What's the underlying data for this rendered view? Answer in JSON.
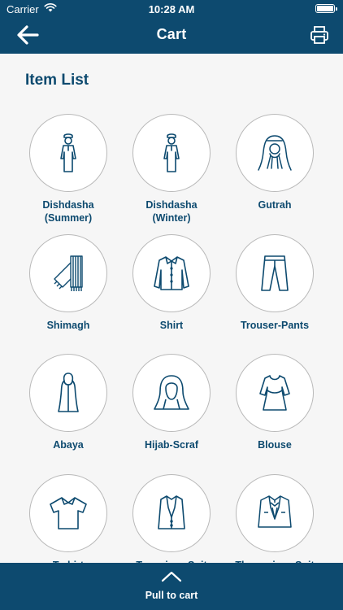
{
  "status_bar": {
    "carrier": "Carrier",
    "time": "10:28 AM"
  },
  "header": {
    "title": "Cart",
    "back_icon": "arrow-left-icon",
    "print_icon": "printer-icon"
  },
  "section": {
    "title": "Item List"
  },
  "items": [
    {
      "label": "Dishdasha\n(Summer)",
      "icon": "dishdasha-icon"
    },
    {
      "label": "Dishdasha\n(Winter)",
      "icon": "dishdasha-icon"
    },
    {
      "label": "Gutrah",
      "icon": "gutrah-icon"
    },
    {
      "label": "Shimagh",
      "icon": "shimagh-icon"
    },
    {
      "label": "Shirt",
      "icon": "shirt-icon"
    },
    {
      "label": "Trouser-Pants",
      "icon": "trousers-icon"
    },
    {
      "label": "Abaya",
      "icon": "abaya-icon"
    },
    {
      "label": "Hijab-Scraf",
      "icon": "hijab-icon"
    },
    {
      "label": "Blouse",
      "icon": "blouse-icon"
    },
    {
      "label": "T-shirt",
      "icon": "tshirt-icon"
    },
    {
      "label": "Two-piece Suit",
      "icon": "two-piece-suit-icon"
    },
    {
      "label": "Three-piece Suit",
      "icon": "three-piece-suit-icon"
    }
  ],
  "footer": {
    "label": "Pull to cart",
    "icon": "chevron-up-icon"
  },
  "colors": {
    "primary": "#0d4a6f",
    "background": "#f6f6f6",
    "circle_border": "#b9b9b9"
  }
}
